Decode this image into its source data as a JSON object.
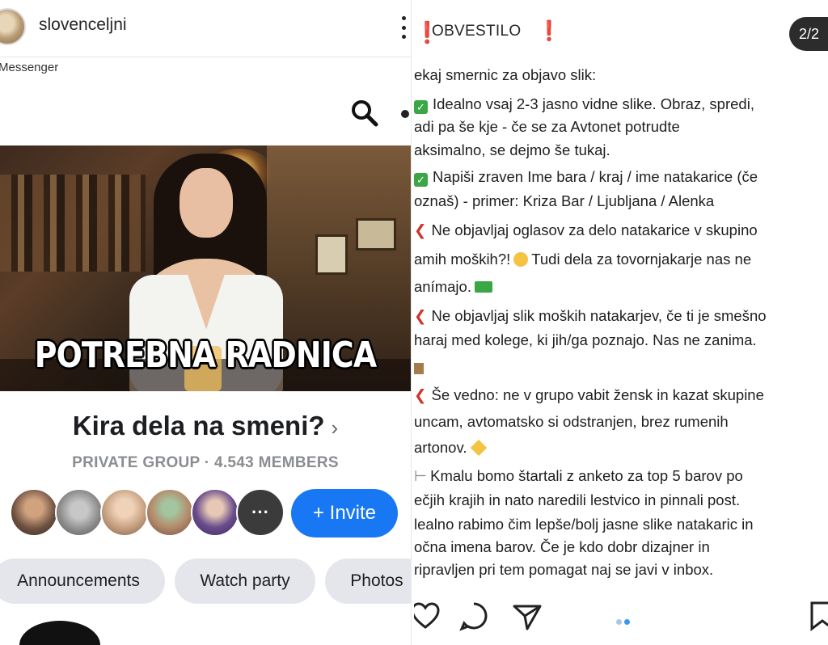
{
  "left": {
    "username": "slovenceljni",
    "messenger_label": "Messenger",
    "photo_caption": "POTREBNA RADNICA",
    "group_name": "Kira dela na smeni?",
    "group_chevron": "›",
    "group_meta": "PRIVATE GROUP · 4.543 MEMBERS",
    "more_members": "···",
    "invite_label": "+ Invite",
    "chips": [
      "Announcements",
      "Watch party",
      "Photos"
    ],
    "member_colors": [
      "#6b5040",
      "#8a8a8a",
      "#c9a384",
      "#b58a6a",
      "#6a4c8c"
    ]
  },
  "right": {
    "title": "OBVESTILO",
    "counter": "2/2",
    "lines": [
      "ekaj smernic za objavo slik:",
      "Idealno vsaj 2-3 jasno vidne slike. Obraz, spredi,",
      "adi pa še kje - če se za Avtonet potrudte",
      "aksimalno, se dejmo še tukaj.",
      "Napiši zraven Ime bara / kraj / ime natakarice (če",
      "oznaš) - primer: Kriza Bar / Ljubljana / Alenka",
      "Ne objavljaj oglasov za delo natakarice v skupino",
      "amih moških?!",
      "Tudi dela za tovornjakarje nas ne",
      "anímajo.",
      "Ne objavljaj slik moških natakarjev, če ti je smešno",
      "haraj med kolege, ki jih/ga poznajo. Nas ne zanima.",
      "Še vedno: ne v grupo vabit žensk in kazat skupine",
      "uncam, avtomatsko si odstranjen, brez rumenih",
      "artonov.",
      "Kmalu bomo štartali z anketo za top 5 barov po",
      "ečjih krajih in nato naredili lestvico in pinnali post.",
      "lealno rabimo čim lepše/bolj jasne slike natakaric in",
      "očna imena barov. Če je kdo dobr dizajner in",
      "ripravljen pri tem pomagat naj se javi v inbox."
    ]
  }
}
